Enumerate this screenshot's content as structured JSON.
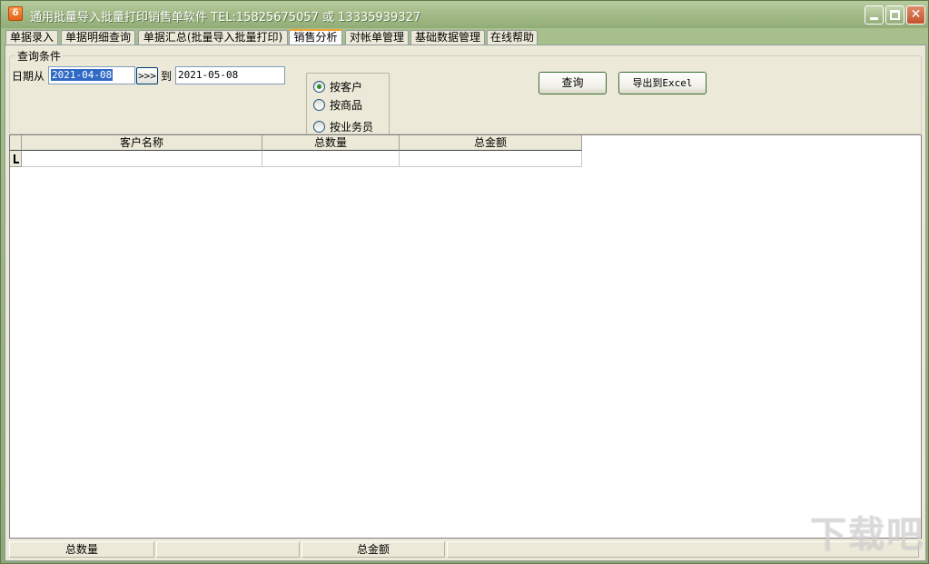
{
  "window": {
    "title": "通用批量导入批量打印销售单软件 TEL:15825675057 或 13335939327",
    "app_icon_glyph": "δ",
    "close_glyph": "✕"
  },
  "tabs": [
    {
      "label": "单据录入"
    },
    {
      "label": "单据明细查询"
    },
    {
      "label": "单据汇总(批量导入批量打印)"
    },
    {
      "label": "销售分析"
    },
    {
      "label": "对帐单管理"
    },
    {
      "label": "基础数据管理"
    },
    {
      "label": "在线帮助"
    }
  ],
  "active_tab": "销售分析",
  "query": {
    "group_title": "查询条件",
    "date_from_label": "日期从",
    "date_from": "2021-04-08",
    "jump_button": ">>>",
    "to_label": "到",
    "date_to": "2021-05-08",
    "radio_options": [
      {
        "label": "按客户",
        "checked": true
      },
      {
        "label": "按商品",
        "checked": false
      },
      {
        "label": "按业务员",
        "checked": false
      }
    ],
    "search_button": "查询",
    "export_button": "导出到Excel"
  },
  "grid": {
    "columns": [
      "客户名称",
      "总数量",
      "总金额"
    ],
    "rows": [
      [
        "",
        "",
        ""
      ]
    ]
  },
  "statusbar": {
    "total_qty_label": "总数量",
    "total_qty_value": "",
    "total_amount_label": "总金额",
    "total_amount_value": ""
  },
  "watermark": "下载吧",
  "colors": {
    "title_bar": "#a3bb88",
    "panel": "#ece9d8",
    "selection": "#316ac5",
    "active_tab_accent": "#f0a030"
  }
}
